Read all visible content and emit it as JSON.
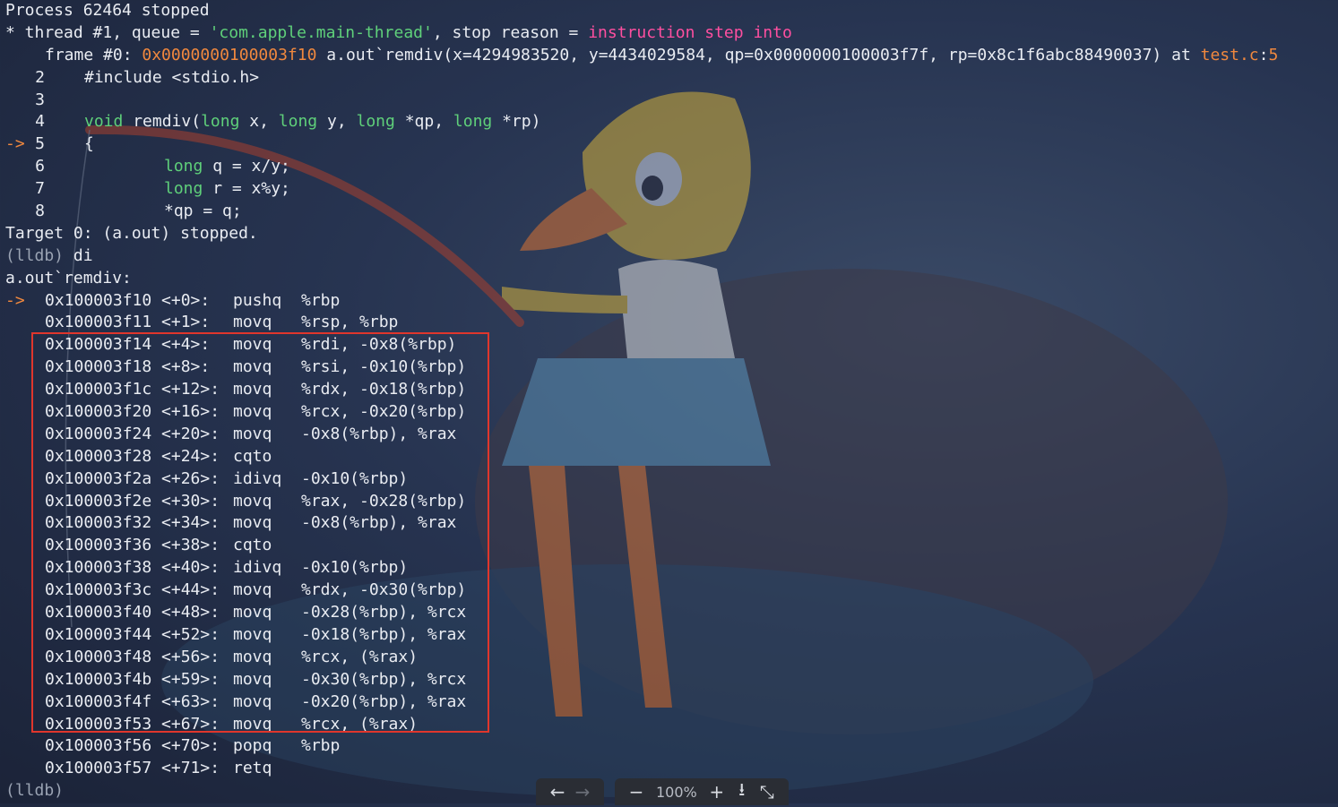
{
  "header": {
    "process": "Process 62464 stopped",
    "thread_prefix": "* thread #1, queue = ",
    "queue": "'com.apple.main-thread'",
    "reason_prefix": ", stop reason = ",
    "reason": "instruction step into",
    "frame_prefix": "frame #0: ",
    "frame_addr": "0x0000000100003f10",
    "frame_func": " a.out`remdiv(x=4294983520, y=4434029584, qp=0x0000000100003f7f, rp=0x8c1f6abc88490037) at ",
    "frame_file": "test.c",
    "frame_sep": ":",
    "frame_line": "5"
  },
  "source": [
    {
      "num": "2",
      "code": "#include <stdio.h>",
      "arrow": ""
    },
    {
      "num": "3",
      "code": "",
      "arrow": ""
    },
    {
      "num": "4",
      "kw1": "void",
      "code": " remdiv(",
      "kw2": "long",
      "c2": " x, ",
      "kw3": "long",
      "c3": " y, ",
      "kw4": "long",
      "c4": " *qp, ",
      "kw5": "long",
      "c5": " *rp)",
      "arrow": ""
    },
    {
      "num": "5",
      "code": "{",
      "arrow": "->"
    },
    {
      "num": "6",
      "kw": "long",
      "code": " q = x/y;"
    },
    {
      "num": "7",
      "kw": "long",
      "code": " r = x%y;"
    },
    {
      "num": "8",
      "code": "*qp = q;"
    }
  ],
  "target_line": "Target 0: (a.out) stopped.",
  "prompt1": "(lldb)",
  "command1": " di",
  "func_label": "a.out`remdiv:",
  "current_arrow": "->",
  "disasm": [
    {
      "addr": "0x100003f10 <+0>:",
      "mn": "pushq",
      "op": "%rbp"
    },
    {
      "addr": "0x100003f11 <+1>:",
      "mn": "movq",
      "op": "%rsp, %rbp"
    },
    {
      "addr": "0x100003f14 <+4>:",
      "mn": "movq",
      "op": "%rdi, -0x8(%rbp)"
    },
    {
      "addr": "0x100003f18 <+8>:",
      "mn": "movq",
      "op": "%rsi, -0x10(%rbp)"
    },
    {
      "addr": "0x100003f1c <+12>:",
      "mn": "movq",
      "op": "%rdx, -0x18(%rbp)"
    },
    {
      "addr": "0x100003f20 <+16>:",
      "mn": "movq",
      "op": "%rcx, -0x20(%rbp)"
    },
    {
      "addr": "0x100003f24 <+20>:",
      "mn": "movq",
      "op": "-0x8(%rbp), %rax"
    },
    {
      "addr": "0x100003f28 <+24>:",
      "mn": "cqto",
      "op": ""
    },
    {
      "addr": "0x100003f2a <+26>:",
      "mn": "idivq",
      "op": "-0x10(%rbp)"
    },
    {
      "addr": "0x100003f2e <+30>:",
      "mn": "movq",
      "op": "%rax, -0x28(%rbp)"
    },
    {
      "addr": "0x100003f32 <+34>:",
      "mn": "movq",
      "op": "-0x8(%rbp), %rax"
    },
    {
      "addr": "0x100003f36 <+38>:",
      "mn": "cqto",
      "op": ""
    },
    {
      "addr": "0x100003f38 <+40>:",
      "mn": "idivq",
      "op": "-0x10(%rbp)"
    },
    {
      "addr": "0x100003f3c <+44>:",
      "mn": "movq",
      "op": "%rdx, -0x30(%rbp)"
    },
    {
      "addr": "0x100003f40 <+48>:",
      "mn": "movq",
      "op": "-0x28(%rbp), %rcx"
    },
    {
      "addr": "0x100003f44 <+52>:",
      "mn": "movq",
      "op": "-0x18(%rbp), %rax"
    },
    {
      "addr": "0x100003f48 <+56>:",
      "mn": "movq",
      "op": "%rcx, (%rax)"
    },
    {
      "addr": "0x100003f4b <+59>:",
      "mn": "movq",
      "op": "-0x30(%rbp), %rcx"
    },
    {
      "addr": "0x100003f4f <+63>:",
      "mn": "movq",
      "op": "-0x20(%rbp), %rax"
    },
    {
      "addr": "0x100003f53 <+67>:",
      "mn": "movq",
      "op": "%rcx, (%rax)"
    },
    {
      "addr": "0x100003f56 <+70>:",
      "mn": "popq",
      "op": "%rbp"
    },
    {
      "addr": "0x100003f57 <+71>:",
      "mn": "retq",
      "op": ""
    }
  ],
  "prompt2": "(lldb)",
  "toolbar": {
    "back": "←",
    "forward": "→",
    "zoom_out": "−",
    "zoom": "100%",
    "zoom_in": "+",
    "download": "⭳",
    "collapse": "⤡"
  },
  "colors": {
    "highlight_box": "#e0362c",
    "keyword": "#5fd07a",
    "address": "#f0883e",
    "reason": "#ff4fa0"
  }
}
